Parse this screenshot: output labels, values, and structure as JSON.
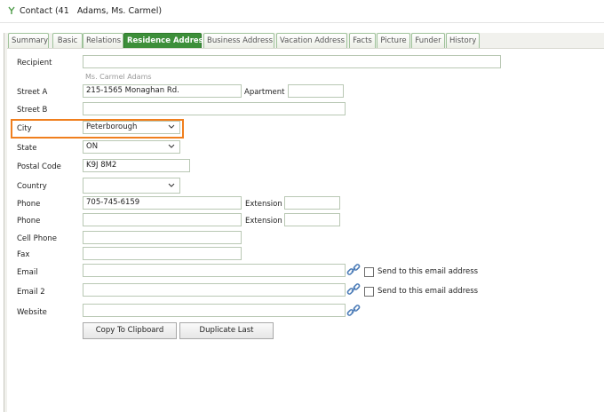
{
  "window": {
    "title": "Contact (41   Adams, Ms. Carmel)"
  },
  "tabs": [
    {
      "label": "Summary"
    },
    {
      "label": "Basic"
    },
    {
      "label": "Relations"
    },
    {
      "label": "Residence Address",
      "active": true
    },
    {
      "label": "Business Address"
    },
    {
      "label": "Vacation Address"
    },
    {
      "label": "Facts"
    },
    {
      "label": "Picture"
    },
    {
      "label": "Funder"
    },
    {
      "label": "History"
    }
  ],
  "form": {
    "recipient": {
      "label": "Recipient",
      "value": "",
      "hint": "Ms. Carmel Adams"
    },
    "street_a": {
      "label": "Street A",
      "value": "215-1565 Monaghan Rd."
    },
    "apartment": {
      "label": "Apartment",
      "value": ""
    },
    "street_b": {
      "label": "Street B",
      "value": ""
    },
    "city": {
      "label": "City",
      "value": "Peterborough"
    },
    "state": {
      "label": "State",
      "value": "ON"
    },
    "postal_code": {
      "label": "Postal Code",
      "value": "K9J 8M2"
    },
    "country": {
      "label": "Country",
      "value": ""
    },
    "phone1": {
      "label": "Phone",
      "value": "705-745-6159"
    },
    "extension1": {
      "label": "Extension",
      "value": ""
    },
    "phone2": {
      "label": "Phone",
      "value": ""
    },
    "extension2": {
      "label": "Extension",
      "value": ""
    },
    "cell_phone": {
      "label": "Cell Phone",
      "value": ""
    },
    "fax": {
      "label": "Fax",
      "value": ""
    },
    "email": {
      "label": "Email",
      "value": "",
      "send_label": "Send to this email address"
    },
    "email2": {
      "label": "Email 2",
      "value": "",
      "send_label": "Send to this email address"
    },
    "website": {
      "label": "Website",
      "value": ""
    }
  },
  "buttons": {
    "copy": "Copy To Clipboard",
    "duplicate": "Duplicate Last"
  },
  "colors": {
    "active_tab": "#3d8f3a",
    "highlight": "#f07f1e"
  },
  "icons": {
    "title": "contact-tree-icon",
    "link": "chain-link-icon",
    "select": "chevron-down-icon"
  }
}
